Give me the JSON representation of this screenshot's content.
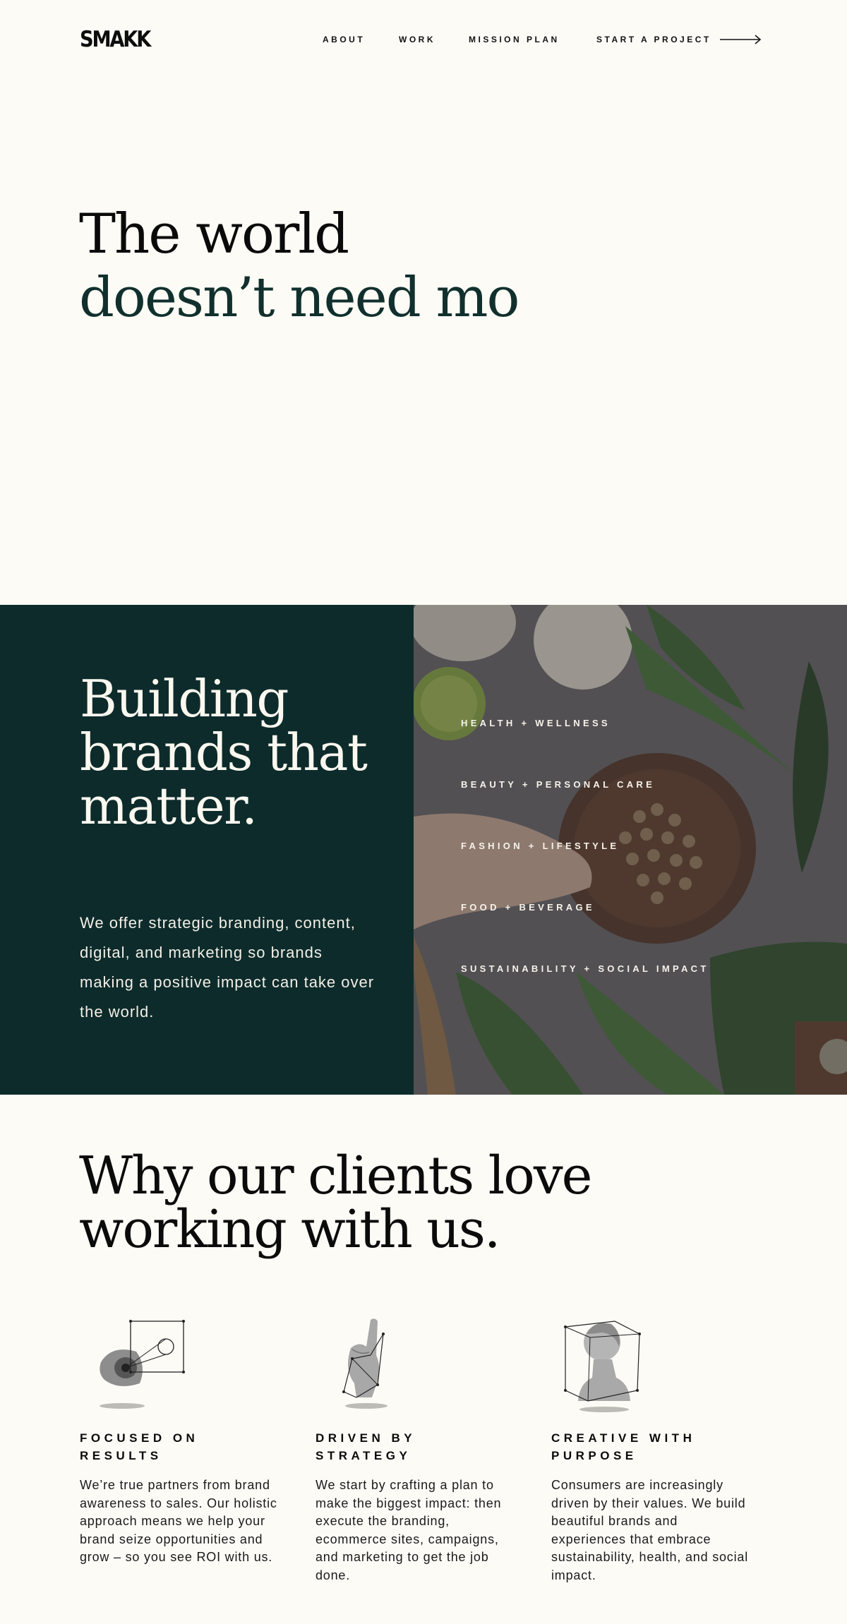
{
  "header": {
    "logo": "SMAKK",
    "nav": {
      "about": "ABOUT",
      "work": "WORK",
      "mission": "MISSION PLAN",
      "start": "START A PROJECT"
    }
  },
  "hero": {
    "line1": "The world",
    "line2": "doesn’t need mo"
  },
  "brands": {
    "title": "Building brands that matter.",
    "text": "We offer strategic branding, content, digital, and marketing so brands making a positive impact can take over the world.",
    "categories": [
      "HEALTH + WELLNESS",
      "BEAUTY + PERSONAL CARE",
      "FASHION + LIFESTYLE",
      "FOOD + BEVERAGE",
      "SUSTAINABILITY  + SOCIAL IMPACT"
    ]
  },
  "why": {
    "title": "Why our clients love working with us.",
    "features": [
      {
        "icon": "eye-sculpture-icon",
        "title": "FOCUSED  ON RESULTS",
        "text": "We’re true partners from brand awareness to sales. Our holistic approach means we help your brand seize opportunities and grow – so you see ROI with us."
      },
      {
        "icon": "hand-sculpture-icon",
        "title": "DRIVEN BY STRATEGY",
        "text": "We start by crafting a plan to make the biggest impact: then execute the branding, ecommerce sites, campaigns, and marketing to get the job done."
      },
      {
        "icon": "bust-sculpture-icon",
        "title": "CREATIVE WITH PURPOSE",
        "text": "Consumers are increasingly driven by their values. We build beautiful brands and experiences that embrace sustainability, health, and social impact."
      }
    ]
  },
  "colors": {
    "background": "#fcfbf6",
    "dark_green": "#0d2b2b",
    "hero_green": "#11302d"
  }
}
